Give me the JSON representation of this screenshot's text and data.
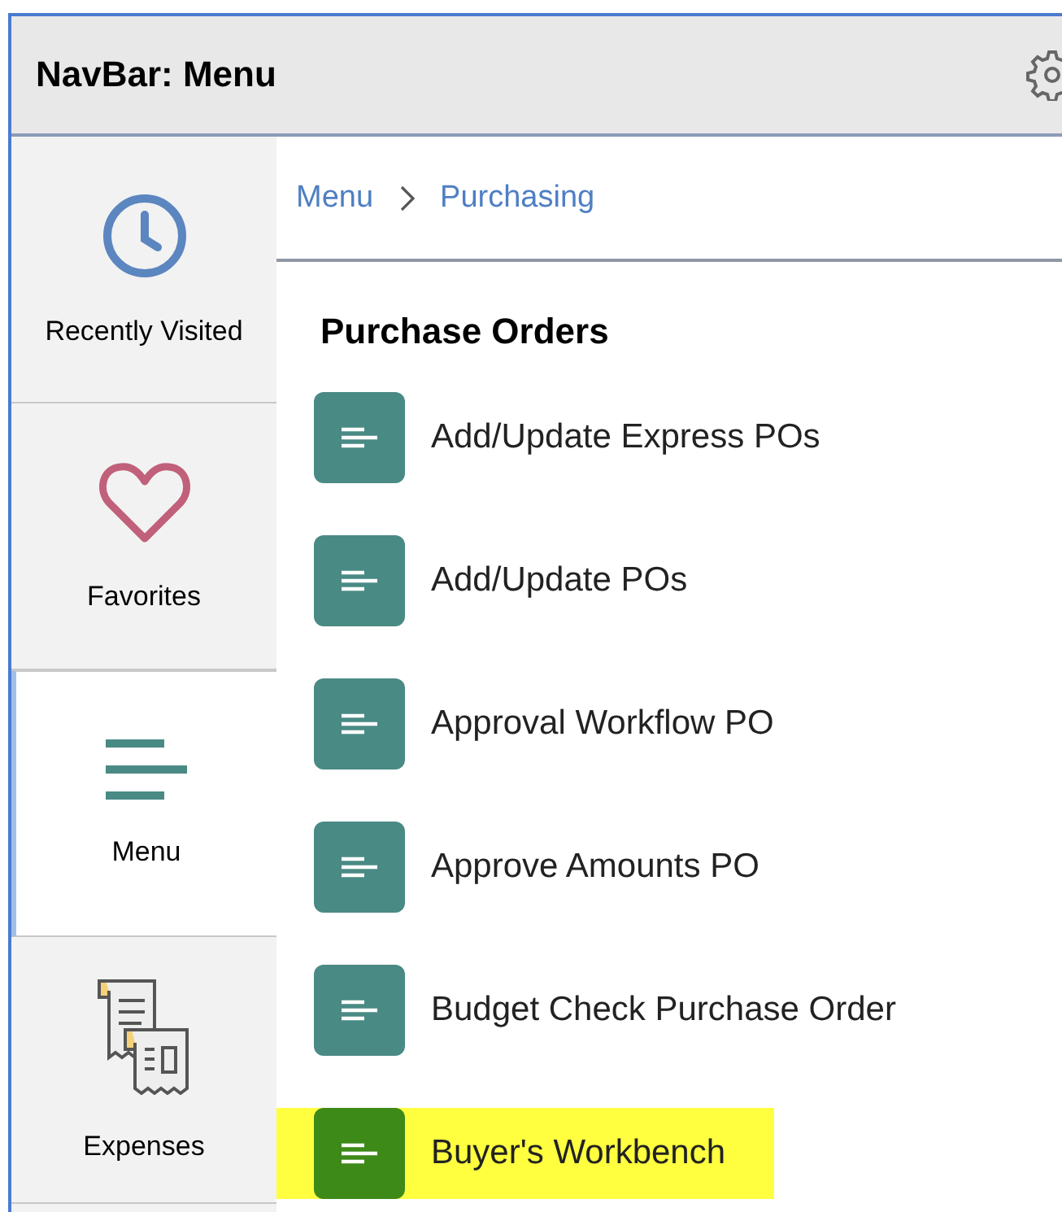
{
  "header": {
    "title": "NavBar: Menu"
  },
  "sidebar": {
    "items": [
      {
        "label": "Recently Visited",
        "kind": "clock",
        "selected": false
      },
      {
        "label": "Favorites",
        "kind": "heart",
        "selected": false
      },
      {
        "label": "Menu",
        "kind": "menu",
        "selected": true
      },
      {
        "label": "Expenses",
        "kind": "receipt",
        "selected": false
      }
    ]
  },
  "breadcrumb": [
    {
      "label": "Menu"
    },
    {
      "label": "Purchasing"
    }
  ],
  "section": {
    "title": "Purchase Orders",
    "items": [
      {
        "label": "Add/Update Express POs",
        "highlighted": false
      },
      {
        "label": "Add/Update POs",
        "highlighted": false
      },
      {
        "label": "Approval Workflow PO",
        "highlighted": false
      },
      {
        "label": "Approve Amounts PO",
        "highlighted": false
      },
      {
        "label": "Budget Check Purchase Order",
        "highlighted": false
      },
      {
        "label": "Buyer's Workbench",
        "highlighted": true
      }
    ]
  }
}
